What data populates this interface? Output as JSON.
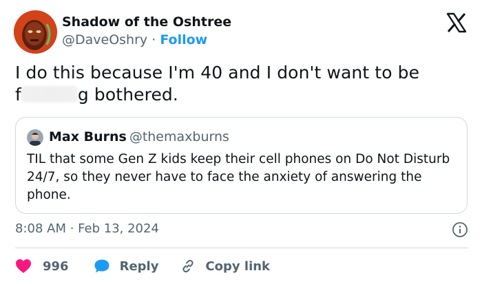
{
  "tweet": {
    "display_name": "Shadow of the Oshtree",
    "handle": "@DaveOshry",
    "separator": "·",
    "follow_label": "Follow",
    "text_line1": "I do this because I'm 40 and I don't want to be",
    "text_line2_prefix": "f",
    "text_line2_suffix": "g bothered.",
    "timestamp": "8:08 AM · Feb 13, 2024"
  },
  "quoted_tweet": {
    "display_name": "Max Burns",
    "handle": "@themaxburns",
    "text": "TIL that some Gen Z kids keep their cell phones on Do Not Disturb 24/7, so they never have to face the anxiety of answering the phone."
  },
  "actions": {
    "like_count": "996",
    "reply_label": "Reply",
    "copy_label": "Copy link"
  },
  "colors": {
    "accent": "#1d9bf0",
    "like": "#f91880",
    "secondary_text": "#536471",
    "border": "#cfd9de"
  },
  "icons": {
    "brand": "x-logo-icon",
    "info": "info-icon",
    "like": "heart-icon",
    "reply": "speech-bubble-icon",
    "copy": "link-icon"
  }
}
